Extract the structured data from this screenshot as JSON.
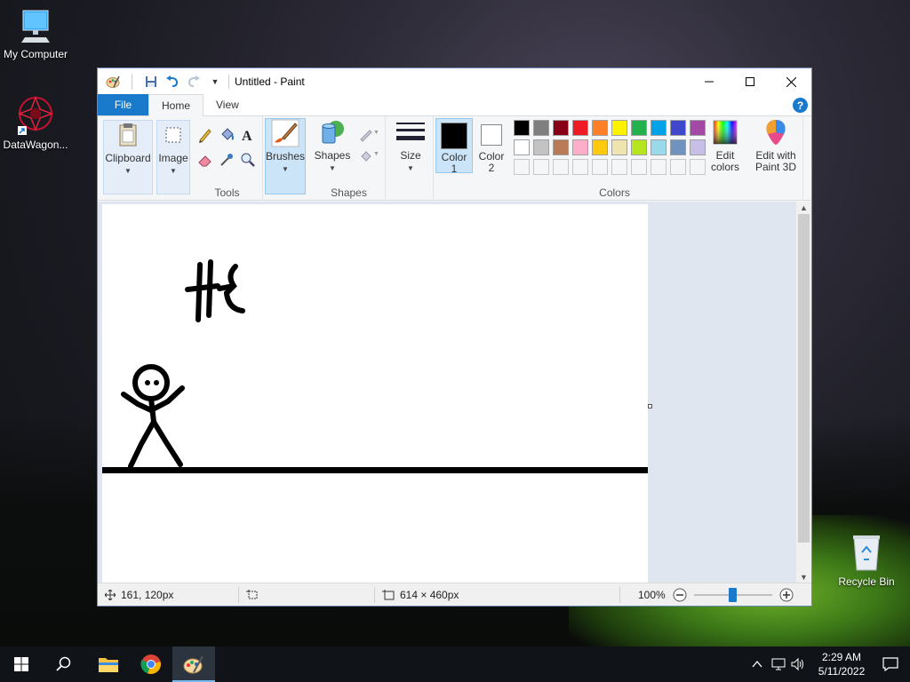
{
  "desktop": {
    "icons": [
      {
        "label": "My Computer"
      },
      {
        "label": "DataWagon..."
      },
      {
        "label": "Recycle Bin"
      }
    ]
  },
  "window": {
    "title": "Untitled - Paint",
    "tabs": {
      "file": "File",
      "home": "Home",
      "view": "View"
    },
    "help": "?"
  },
  "ribbon": {
    "clipboard": "Clipboard",
    "image": "Image",
    "tools_label": "Tools",
    "brushes": "Brushes",
    "shapes": "Shapes",
    "shapes_label": "Shapes",
    "size": "Size",
    "color1": "Color 1",
    "color2": "Color 2",
    "colors_label": "Colors",
    "edit_colors": "Edit colors",
    "edit_paint3d": "Edit with Paint 3D",
    "palette_row1": [
      "#000000",
      "#7f7f7f",
      "#880015",
      "#ed1c24",
      "#ff7f27",
      "#fff200",
      "#22b14c",
      "#00a2e8",
      "#3f48cc",
      "#a349a4"
    ],
    "palette_row2": [
      "#ffffff",
      "#c3c3c3",
      "#b97a57",
      "#ffaec9",
      "#ffc90e",
      "#efe4b0",
      "#b5e61d",
      "#99d9ea",
      "#7092be",
      "#c8bfe7"
    ],
    "color1_value": "#000000",
    "color2_value": "#ffffff"
  },
  "status": {
    "cursor_pos": "161, 120px",
    "canvas_size": "614 × 460px",
    "zoom": "100%",
    "zoom_level": 0.5
  },
  "taskbar": {
    "time": "2:29 AM",
    "date": "5/11/2022"
  }
}
